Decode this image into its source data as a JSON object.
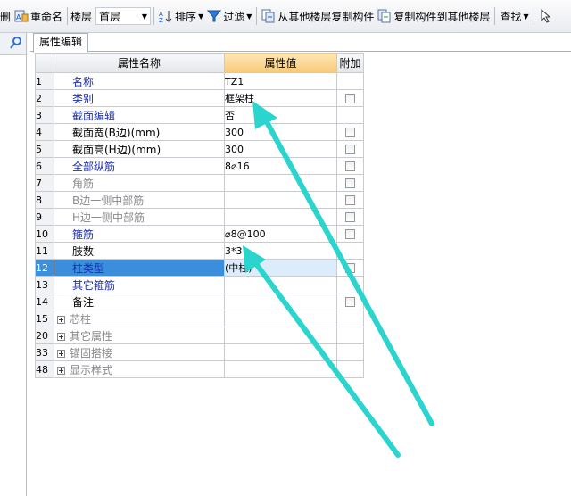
{
  "toolbar": {
    "cut_label": "删",
    "rename_label": "重命名",
    "floor_label": "楼层",
    "floor_value": "首层",
    "sort_label": "排序",
    "filter_label": "过滤",
    "copy_from_label": "从其他楼层复制构件",
    "copy_to_label": "复制构件到其他楼层",
    "find_label": "查找"
  },
  "panel": {
    "tab_label": "属性编辑"
  },
  "grid": {
    "headers": {
      "name": "属性名称",
      "value": "属性值",
      "extra": "附加"
    },
    "rows": [
      {
        "num": "1",
        "name": "名称",
        "value": "TZ1",
        "checkbox": false,
        "color": "blue"
      },
      {
        "num": "2",
        "name": "类别",
        "value": "框架柱",
        "checkbox": true,
        "color": "blue"
      },
      {
        "num": "3",
        "name": "截面编辑",
        "value": "否",
        "checkbox": false,
        "color": "blue"
      },
      {
        "num": "4",
        "name": "截面宽(B边)(mm)",
        "value": "300",
        "checkbox": true,
        "color": "black"
      },
      {
        "num": "5",
        "name": "截面高(H边)(mm)",
        "value": "300",
        "checkbox": true,
        "color": "black"
      },
      {
        "num": "6",
        "name": "全部纵筋",
        "value": "8⌀16",
        "checkbox": true,
        "color": "blue"
      },
      {
        "num": "7",
        "name": "角筋",
        "value": "",
        "checkbox": true,
        "color": "gray"
      },
      {
        "num": "8",
        "name": "B边一侧中部筋",
        "value": "",
        "checkbox": true,
        "color": "gray"
      },
      {
        "num": "9",
        "name": "H边一侧中部筋",
        "value": "",
        "checkbox": true,
        "color": "gray"
      },
      {
        "num": "10",
        "name": "箍筋",
        "value": "⌀8@100",
        "checkbox": true,
        "color": "blue"
      },
      {
        "num": "11",
        "name": "肢数",
        "value": "3*3",
        "checkbox": false,
        "color": "black"
      },
      {
        "num": "12",
        "name": "柱类型",
        "value": "(中柱)",
        "checkbox": true,
        "color": "blue",
        "selected": true
      },
      {
        "num": "13",
        "name": "其它箍筋",
        "value": "",
        "checkbox": false,
        "color": "blue"
      },
      {
        "num": "14",
        "name": "备注",
        "value": "",
        "checkbox": true,
        "color": "black"
      }
    ],
    "groups": [
      {
        "num": "15",
        "name": "芯柱"
      },
      {
        "num": "20",
        "name": "其它属性"
      },
      {
        "num": "33",
        "name": "锚固搭接"
      },
      {
        "num": "48",
        "name": "显示样式"
      }
    ]
  },
  "icons": {
    "search": "search-icon",
    "rename": "rename-icon",
    "sort": "sort-icon",
    "filter": "filter-icon",
    "copy_from": "copy-from-floor-icon",
    "copy_to": "copy-to-floor-icon",
    "annotation_arrow": "annotation-arrow"
  },
  "colors": {
    "selection": "#3a8edb",
    "value_header": "#f8c97a",
    "annotation_arrow": "#2bd4cc",
    "blue_text": "#1a2fb4"
  }
}
